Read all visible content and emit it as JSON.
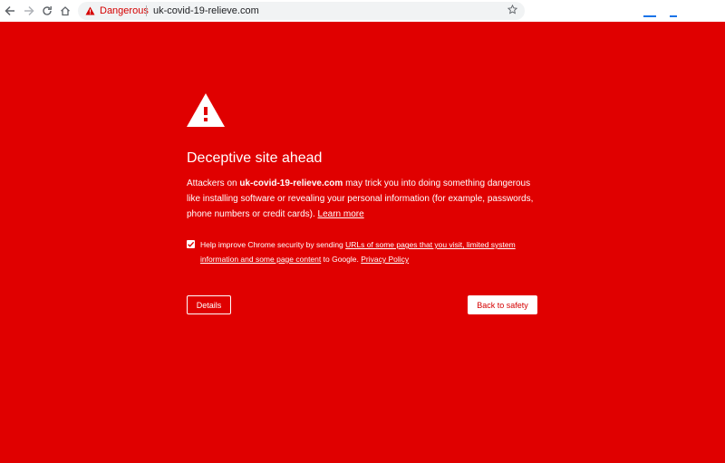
{
  "toolbar": {
    "back_icon": "arrow-left-icon",
    "forward_icon": "arrow-right-icon",
    "reload_icon": "reload-icon",
    "home_icon": "home-icon",
    "security_chip_label": "Dangerous",
    "url": "uk-covid-19-relieve.com",
    "bookmark_icon": "star-icon"
  },
  "interstitial": {
    "icon": "warning-triangle-icon",
    "heading": "Deceptive site ahead",
    "message": {
      "prefix": "Attackers on ",
      "domain": "uk-covid-19-relieve.com",
      "line1_rest": " may trick you into doing something dangerous",
      "line2": "like installing software or revealing your personal information (for example, passwords,",
      "line3": "phone numbers or credit cards). ",
      "learn_more": "Learn more"
    },
    "optin": {
      "checked": true,
      "text_before": "Help improve Chrome security by sending ",
      "link_line1": "URLs of some pages that you visit, limited system",
      "link_line2": "information and some page content",
      "text_after": " to Google. ",
      "privacy_link": "Privacy Policy"
    },
    "details_label": "Details",
    "back_label": "Back to safety"
  },
  "colors": {
    "page_background": "#e00000",
    "danger_text": "#d50000",
    "toolbar_background": "#ffffff",
    "omnibox_background": "#f1f3f4",
    "text": "#ffffff"
  }
}
